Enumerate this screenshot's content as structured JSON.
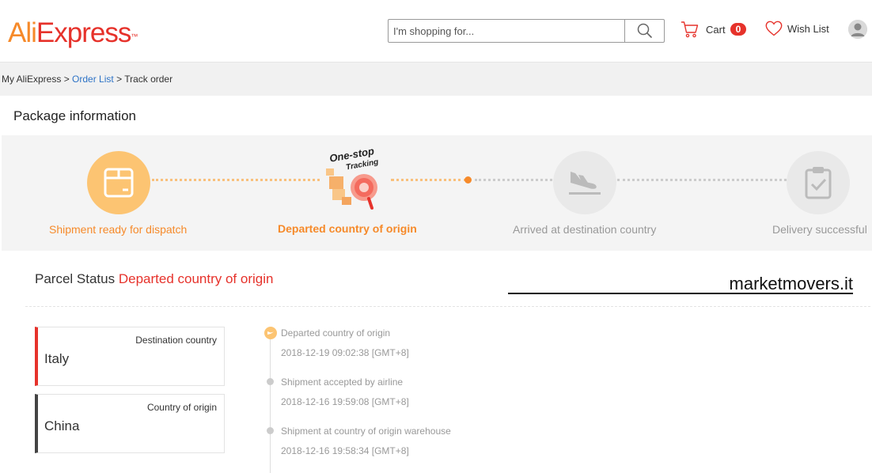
{
  "header": {
    "logo_ali": "Ali",
    "logo_express": "Express",
    "logo_tm": "™",
    "search_placeholder": "I'm shopping for...",
    "cart_label": "Cart",
    "cart_count": "0",
    "wishlist_label": "Wish List"
  },
  "breadcrumb": {
    "home": "My AliExpress",
    "sep1": " > ",
    "order_list": "Order List",
    "sep2": " > ",
    "current": "Track order"
  },
  "package": {
    "title": "Package information",
    "badge_line1": "One-stop",
    "badge_line2": "Tracking",
    "steps": [
      {
        "label": "Shipment ready for dispatch",
        "icon": "box-icon"
      },
      {
        "label": "Departed country of origin",
        "icon": "one-stop-tracking-icon"
      },
      {
        "label": "Arrived at destination country",
        "icon": "plane-landing-icon"
      },
      {
        "label": "Delivery successful",
        "icon": "clipboard-check-icon"
      }
    ]
  },
  "parcel": {
    "label": "Parcel Status",
    "value": "Departed country of origin",
    "watermark": "marketmovers.it"
  },
  "cards": [
    {
      "title": "Destination country",
      "value": "Italy"
    },
    {
      "title": "Country of origin",
      "value": "China"
    }
  ],
  "timeline": [
    {
      "event": "Departed country of origin",
      "time": "2018-12-19 09:02:38 [GMT+8]"
    },
    {
      "event": "Shipment accepted by airline",
      "time": "2018-12-16 19:59:08 [GMT+8]"
    },
    {
      "event": "Shipment at country of origin warehouse",
      "time": "2018-12-16 19:58:34 [GMT+8]"
    }
  ],
  "colors": {
    "orange": "#f68a2a",
    "red": "#e6322b",
    "link": "#2e73c6"
  }
}
